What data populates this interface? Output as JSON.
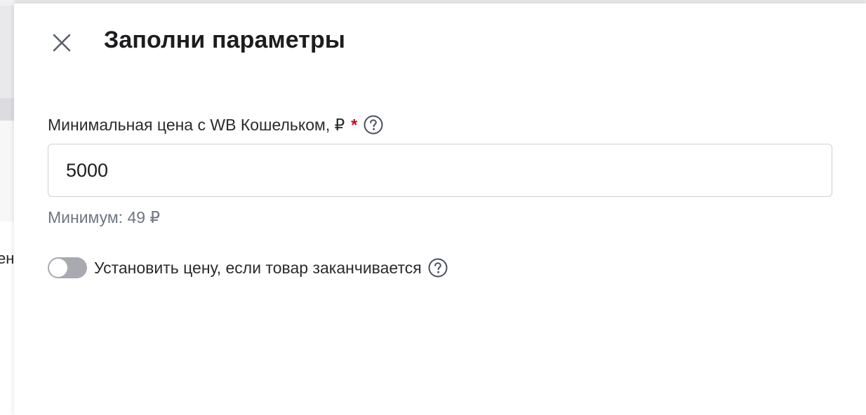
{
  "background": {
    "fragment_text": "ен"
  },
  "drawer": {
    "title": "Заполни параметры",
    "close_icon": "close-icon"
  },
  "min_price_field": {
    "label": "Минимальная цена с WB Кошельком, ₽",
    "required_mark": "*",
    "help_icon": "question-circle-icon",
    "value": "5000",
    "hint": "Минимум: 49 ₽"
  },
  "out_of_stock_toggle": {
    "label": "Установить цену, если товар заканчивается",
    "state": "off",
    "help_icon": "question-circle-icon"
  },
  "colors": {
    "required": "#d0021b",
    "toggle_off": "#a9a9b1",
    "hint_text": "#6f7582",
    "input_border": "#cfcfd4"
  }
}
